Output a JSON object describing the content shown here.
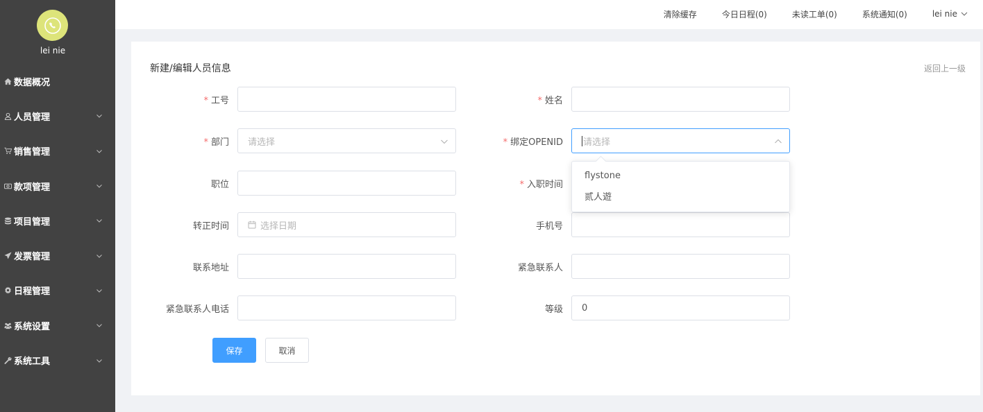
{
  "sidebar": {
    "username": "lei nie",
    "menu": [
      {
        "label": "数据概况",
        "icon": "home-icon",
        "has_submenu": false
      },
      {
        "label": "人员管理",
        "icon": "user-icon",
        "has_submenu": true
      },
      {
        "label": "销售管理",
        "icon": "cart-icon",
        "has_submenu": true
      },
      {
        "label": "款项管理",
        "icon": "money-icon",
        "has_submenu": true
      },
      {
        "label": "项目管理",
        "icon": "database-icon",
        "has_submenu": true
      },
      {
        "label": "发票管理",
        "icon": "send-icon",
        "has_submenu": true
      },
      {
        "label": "日程管理",
        "icon": "gear-icon",
        "has_submenu": true
      },
      {
        "label": "系统设置",
        "icon": "users-icon",
        "has_submenu": true
      },
      {
        "label": "系统工具",
        "icon": "wrench-icon",
        "has_submenu": true
      }
    ]
  },
  "topbar": {
    "clear_cache": "清除缓存",
    "today_schedule": "今日日程(0)",
    "unread_tickets": "未读工单(0)",
    "system_notice": "系统通知(0)",
    "user": "lei nie"
  },
  "page": {
    "title": "新建/编辑人员信息",
    "back": "返回上一级"
  },
  "form": {
    "job_no": {
      "label": "工号",
      "value": "",
      "required": true
    },
    "name": {
      "label": "姓名",
      "value": "",
      "required": true
    },
    "department": {
      "label": "部门",
      "placeholder": "请选择",
      "required": true
    },
    "openid": {
      "label": "绑定OPENID",
      "placeholder": "请选择",
      "required": true,
      "options": [
        "flystone",
        "贰人遊"
      ]
    },
    "position": {
      "label": "职位",
      "value": ""
    },
    "hire_date": {
      "label": "入职时间",
      "required": true
    },
    "regular_date": {
      "label": "转正时间",
      "placeholder": "选择日期"
    },
    "phone": {
      "label": "手机号",
      "value": ""
    },
    "address": {
      "label": "联系地址",
      "value": ""
    },
    "emergency_contact": {
      "label": "紧急联系人",
      "value": ""
    },
    "emergency_phone": {
      "label": "紧急联系人电话",
      "value": ""
    },
    "level": {
      "label": "等级",
      "value": "0"
    }
  },
  "buttons": {
    "save": "保存",
    "cancel": "取消"
  },
  "colors": {
    "sidebar_bg": "#424242",
    "primary": "#409eff",
    "required": "#f56c6c",
    "avatar_bg": "#dde47a"
  }
}
